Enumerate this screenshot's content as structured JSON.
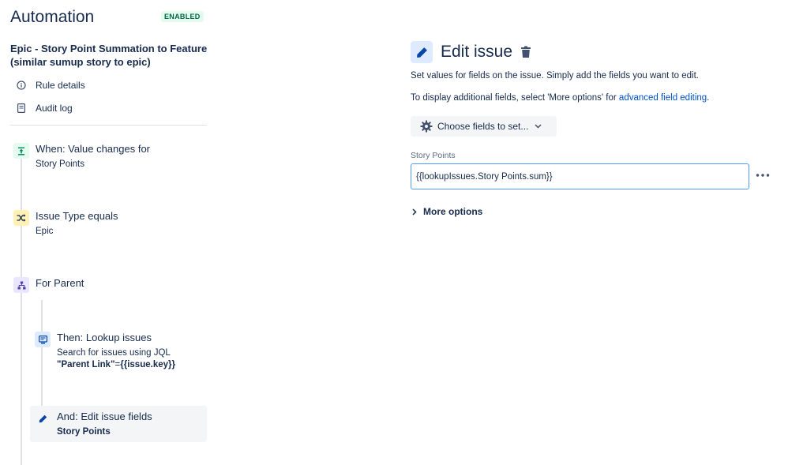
{
  "app": {
    "title": "Automation",
    "status_badge": "ENABLED"
  },
  "rule": {
    "title": "Epic - Story Point Summation to Feature (similar sumup story to epic)"
  },
  "nav": {
    "rule_details": "Rule details",
    "audit_log": "Audit log"
  },
  "steps": {
    "trigger": {
      "title": "When: Value changes for",
      "subtitle": "Story Points",
      "icon": "trigger-icon",
      "color": "#e3fcef"
    },
    "condition": {
      "title": "Issue Type equals",
      "subtitle": "Epic",
      "icon": "shuffle-icon",
      "color": "#fff0b3"
    },
    "branch": {
      "title": "For Parent",
      "icon": "hierarchy-icon",
      "color": "#eae6ff"
    },
    "lookup": {
      "title": "Then: Lookup issues",
      "subtitle": "Search for issues using JQL",
      "jql_bold": "\"Parent Link\"",
      "jql_eq": "=",
      "jql_value": "{{issue.key}}",
      "icon": "lookup-icon",
      "color": "#deebff"
    },
    "edit": {
      "title": "And: Edit issue fields",
      "subtitle": "Story Points",
      "icon": "pencil-icon",
      "color": "#deebff"
    }
  },
  "editor": {
    "title": "Edit issue",
    "desc1": "Set values for fields on the issue. Simply add the fields you want to edit.",
    "desc2_prefix": "To display additional fields, select 'More options' for ",
    "desc2_link": "advanced field editing",
    "desc2_suffix": ".",
    "choose_fields": "Choose fields to set...",
    "field_label": "Story Points",
    "field_value": "{{lookupIssues.Story Points.sum}}",
    "more_options": "More options"
  },
  "colors": {
    "link": "#0052cc",
    "text": "#172b4d",
    "badge_bg": "#e3fcef",
    "badge_text": "#006644",
    "focus_border": "#4c9aff"
  }
}
